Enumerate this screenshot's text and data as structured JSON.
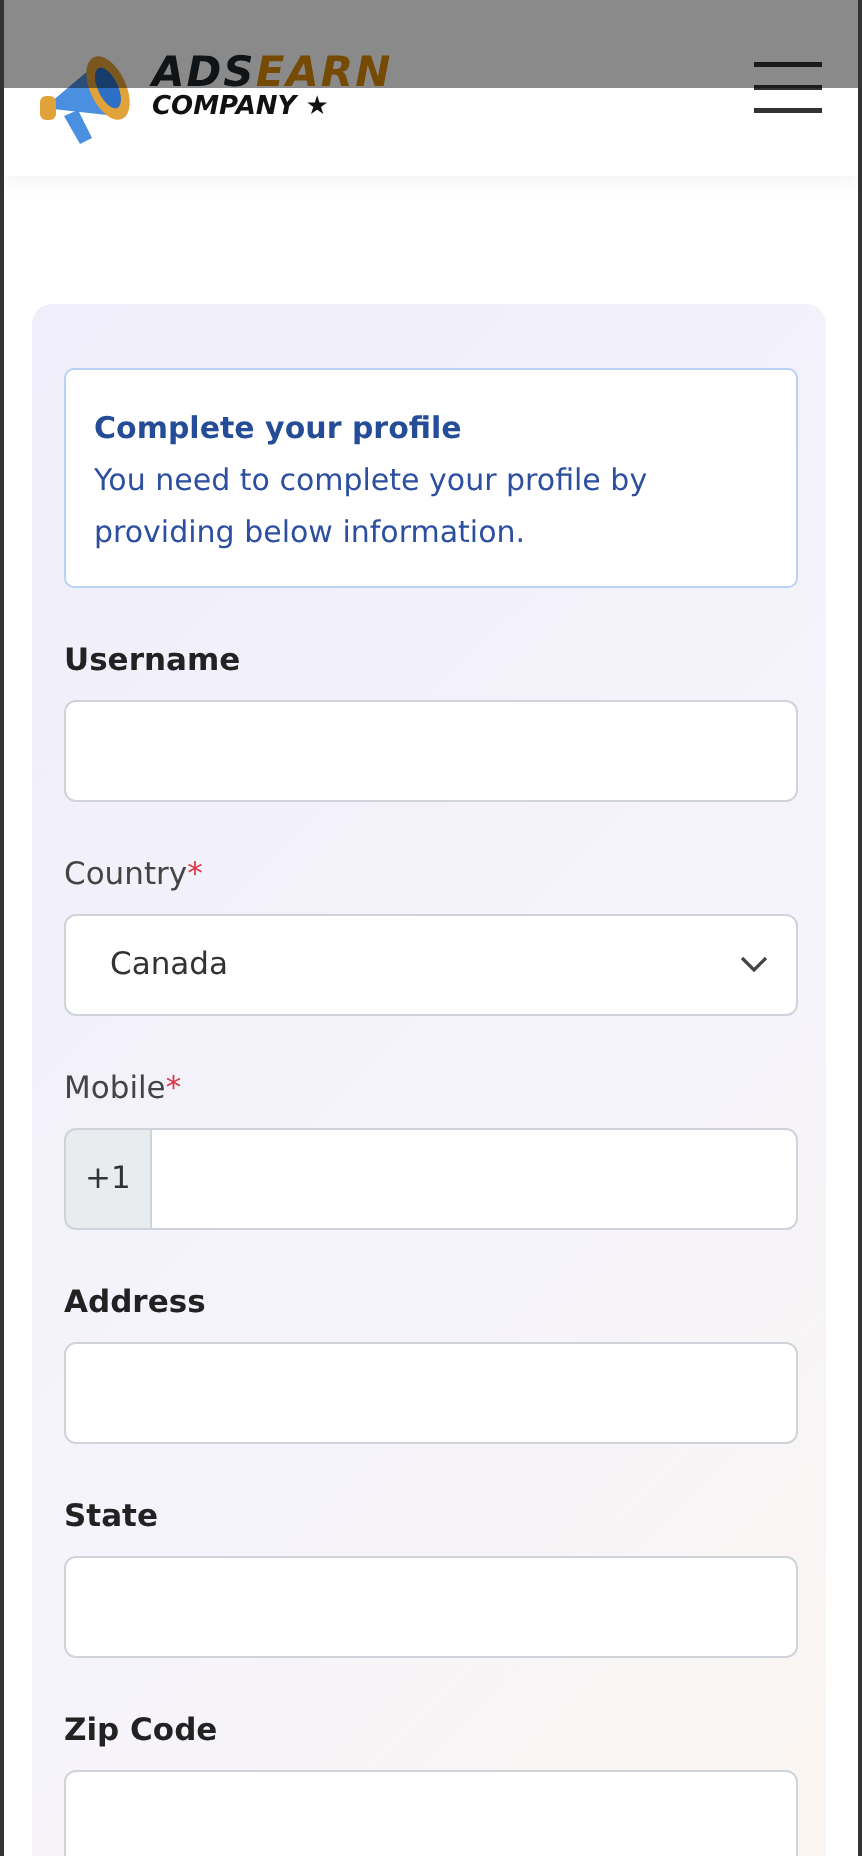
{
  "header": {
    "logo_top": "ADS",
    "logo_accent": "EARN",
    "logo_bottom": "COMPANY ★"
  },
  "alert": {
    "title": "Complete your profile",
    "message": "You need to complete your profile by providing below information."
  },
  "fields": [
    {
      "kind": "text",
      "label": "Username"
    },
    {
      "kind": "select",
      "label": "Country",
      "required_mark": "*",
      "value": "Canada"
    },
    {
      "kind": "phone",
      "label": "Mobile",
      "required_mark": "*",
      "prefix": "+1"
    },
    {
      "kind": "text",
      "label": "Address"
    },
    {
      "kind": "text",
      "label": "State"
    },
    {
      "kind": "text",
      "label": "Zip Code"
    }
  ]
}
